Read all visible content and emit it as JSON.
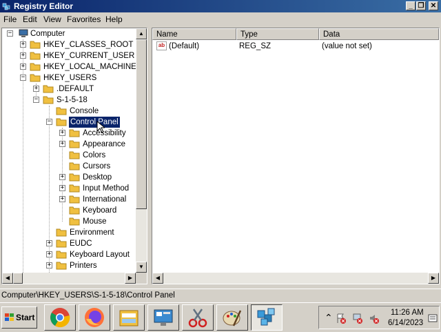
{
  "window": {
    "title": "Registry Editor",
    "min_glyph": "_",
    "max_glyph": "❐",
    "close_glyph": "✕"
  },
  "menu": [
    "File",
    "Edit",
    "View",
    "Favorites",
    "Help"
  ],
  "tree": {
    "computer": "Computer",
    "hkcr": "HKEY_CLASSES_ROOT",
    "hkcu": "HKEY_CURRENT_USER",
    "hklm": "HKEY_LOCAL_MACHINE",
    "hku": "HKEY_USERS",
    "default": ".DEFAULT",
    "s1518": "S-1-5-18",
    "console": "Console",
    "control_panel": "Control Panel",
    "accessibility": "Accessibility",
    "appearance": "Appearance",
    "colors": "Colors",
    "cursors": "Cursors",
    "desktop": "Desktop",
    "input_method": "Input Method",
    "international": "International",
    "keyboard": "Keyboard",
    "mouse": "Mouse",
    "environment": "Environment",
    "eudc": "EUDC",
    "keyboard_layout": "Keyboard Layout",
    "printers": "Printers"
  },
  "columns": {
    "name": "Name",
    "type": "Type",
    "data": "Data"
  },
  "values": [
    {
      "icon": "ab",
      "name": "(Default)",
      "type": "REG_SZ",
      "data": "(value not set)"
    }
  ],
  "status": "Computer\\HKEY_USERS\\S-1-5-18\\Control Panel",
  "taskbar": {
    "start_label": "Start",
    "apps": [
      "chrome-icon",
      "firefox-icon",
      "file-explorer-icon",
      "control-panel-icon",
      "snipping-tool-icon",
      "paint-icon",
      "registry-editor-icon"
    ],
    "time": "11:26 AM",
    "date": "6/14/2023",
    "tray_expand_glyph": "⌃"
  }
}
